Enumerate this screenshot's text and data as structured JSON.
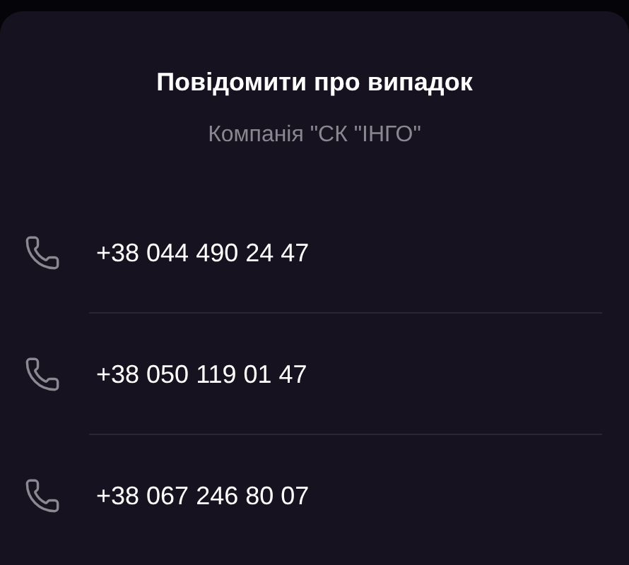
{
  "sheet": {
    "title": "Повідомити про випадок",
    "subtitle": "Компанія \"СК \"ІНГО\""
  },
  "phones": [
    {
      "number": "+38 044 490 24 47"
    },
    {
      "number": "+38 050 119 01 47"
    },
    {
      "number": "+38 067 246 80 07"
    }
  ]
}
